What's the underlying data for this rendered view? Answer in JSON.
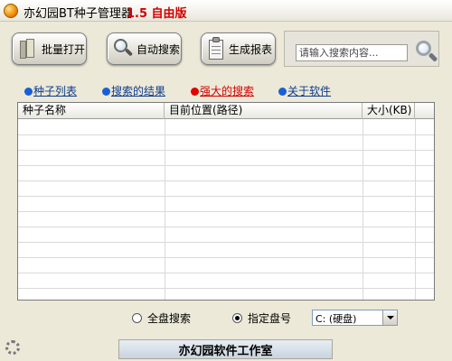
{
  "window": {
    "title": "亦幻园BT种子管理器",
    "version": "1.5 自由版"
  },
  "toolbar": {
    "batch_open_label": "批量打开",
    "auto_search_label": "自动搜索",
    "generate_report_label": "生成报表",
    "search_placeholder": "请输入搜索内容..."
  },
  "tabs": [
    {
      "label": "种子列表",
      "color": "#0f3c8c",
      "icon": "blue-dot-icon"
    },
    {
      "label": "搜索的结果",
      "color": "#0f3c8c",
      "icon": "blue-dot-icon"
    },
    {
      "label": "强大的搜索",
      "color": "#d00000",
      "icon": "red-dot-icon"
    },
    {
      "label": "关于软件",
      "color": "#0f3c8c",
      "icon": "blue-dot-icon"
    }
  ],
  "table": {
    "columns": [
      "种子名称",
      "目前位置(路径)",
      "大小(KB)",
      ""
    ],
    "rows": []
  },
  "scan_options": {
    "all_disks_label": "全盘搜索",
    "specific_drive_label": "指定盘号",
    "selected_option": "specific_drive",
    "drive_value": "C: (硬盘)"
  },
  "status_bar": {
    "text": "亦幻园软件工作室"
  }
}
